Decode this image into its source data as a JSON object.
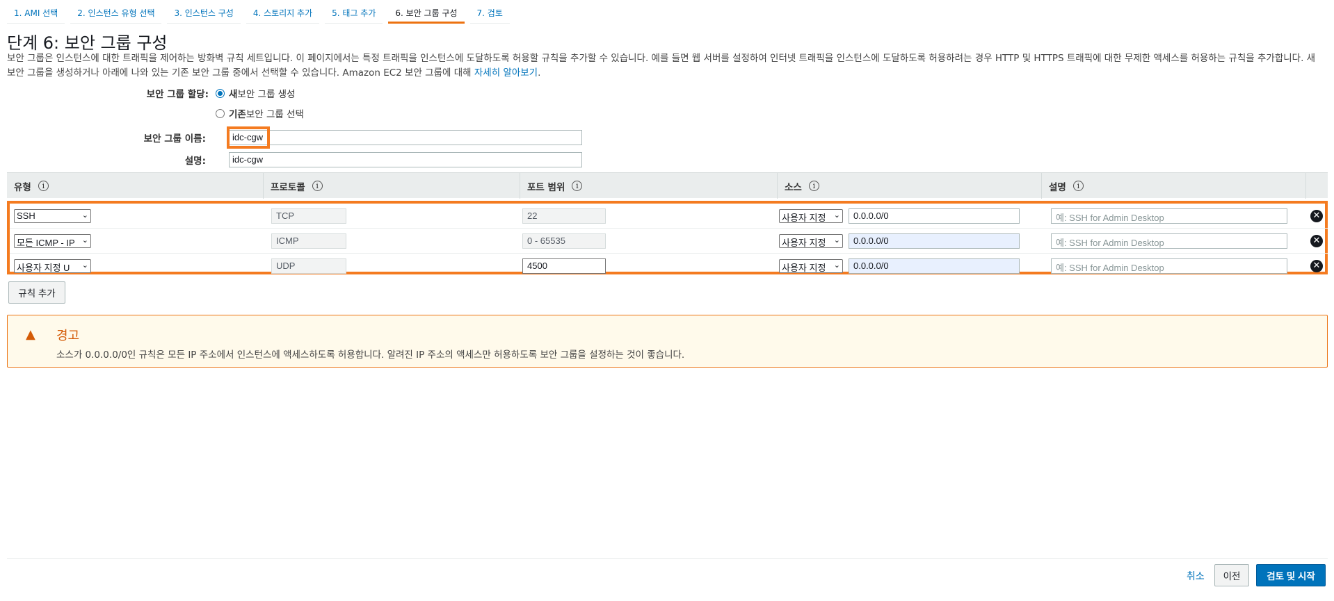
{
  "tabs": [
    {
      "label": "1. AMI 선택"
    },
    {
      "label": "2. 인스턴스 유형 선택"
    },
    {
      "label": "3. 인스턴스 구성"
    },
    {
      "label": "4. 스토리지 추가"
    },
    {
      "label": "5. 태그 추가"
    },
    {
      "label": "6. 보안 그룹 구성"
    },
    {
      "label": "7. 검토"
    }
  ],
  "page": {
    "title": "단계 6: 보안 그룹 구성",
    "intro_text": "보안 그룹은 인스턴스에 대한 트래픽을 제어하는 방화벽 규칙 세트입니다. 이 페이지에서는 특정 트래픽을 인스턴스에 도달하도록 허용할 규칙을 추가할 수 있습니다. 예를 들면 웹 서버를 설정하여 인터넷 트래픽을 인스턴스에 도달하도록 허용하려는 경우 HTTP 및 HTTPS 트래픽에 대한 무제한 액세스를 허용하는 규칙을 추가합니다. 새 보안 그룹을 생성하거나 아래에 나와 있는 기존 보안 그룹 중에서 선택할 수 있습니다. Amazon EC2 보안 그룹에 대해 ",
    "learn_more": "자세히 알아보기",
    "intro_end": "."
  },
  "form": {
    "assign_label": "보안 그룹 할당:",
    "option_new_bold": "새",
    "option_new_rest": " 보안 그룹 생성",
    "option_existing_bold": "기존",
    "option_existing_rest": " 보안 그룹 선택",
    "name_label": "보안 그룹 이름:",
    "name_value": "idc-cgw",
    "desc_label": "설명:",
    "desc_value": "idc-cgw"
  },
  "table": {
    "headers": [
      "유형",
      "프로토콜",
      "포트 범위",
      "소스",
      "설명"
    ],
    "info_glyph": "i",
    "rows": [
      {
        "type": "SSH",
        "protocol": "TCP",
        "port": "22",
        "source_type": "사용자 지정",
        "source": "0.0.0.0/0",
        "desc_placeholder": "예: SSH for Admin Desktop"
      },
      {
        "type": "모든 ICMP - IP",
        "protocol": "ICMP",
        "port": "0 - 65535",
        "source_type": "사용자 지정",
        "source": "0.0.0.0/0",
        "desc_placeholder": "예: SSH for Admin Desktop"
      },
      {
        "type": "사용자 지정 U",
        "protocol": "UDP",
        "port": "4500",
        "source_type": "사용자 지정",
        "source": "0.0.0.0/0",
        "desc_placeholder": "예: SSH for Admin Desktop"
      }
    ],
    "add_rule": "규칙 추가"
  },
  "warning": {
    "title": "경고",
    "text": "소스가 0.0.0.0/0인 규칙은 모든 IP 주소에서 인스턴스에 액세스하도록 허용합니다. 알려진 IP 주소의 액세스만 허용하도록 보안 그룹을 설정하는 것이 좋습니다."
  },
  "footer": {
    "cancel": "취소",
    "previous": "이전",
    "review_launch": "검토 및 시작"
  },
  "colors": {
    "accent_orange": "#ec7211",
    "link_blue": "#0073bb"
  },
  "icons": {
    "info": "info-icon",
    "warning": "warning-triangle-icon",
    "remove": "remove-rule-icon",
    "chevron": "chevron-down-icon"
  }
}
